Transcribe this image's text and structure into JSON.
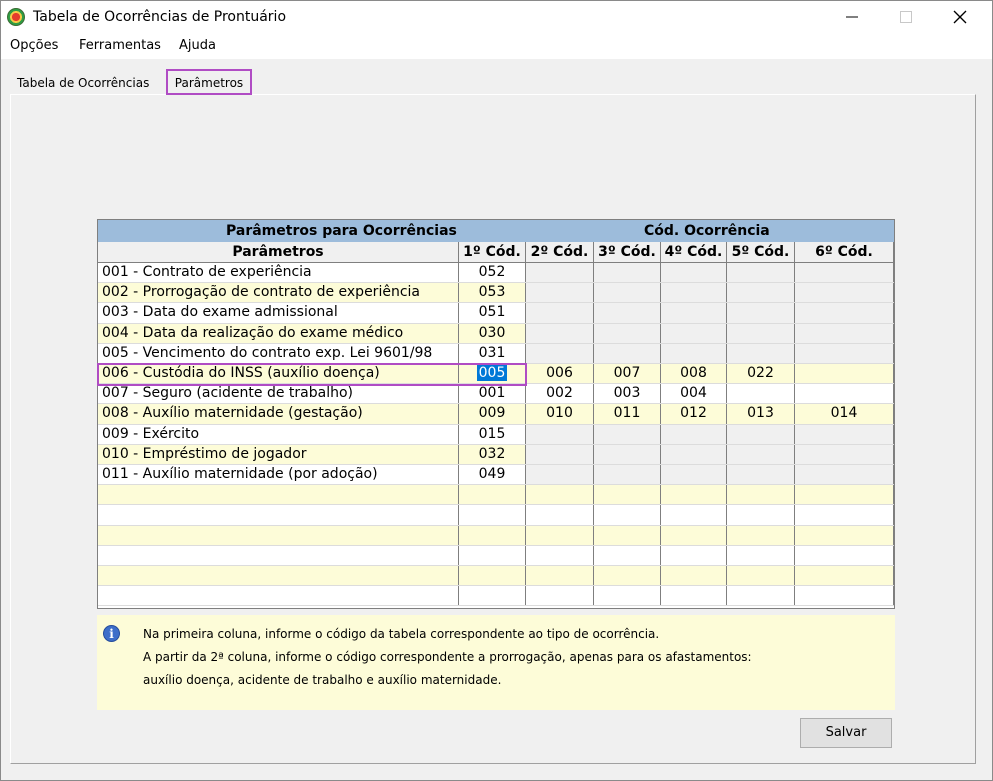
{
  "window": {
    "title": "Tabela de Ocorrências de Prontuário",
    "icon": "app-logo-icon"
  },
  "controls": {
    "minimize": "minimize-icon",
    "maximize": "maximize-icon",
    "close": "close-icon"
  },
  "menu": [
    "Opções",
    "Ferramentas",
    "Ajuda"
  ],
  "tabs": [
    {
      "label": "Tabela de Ocorrências",
      "active": false
    },
    {
      "label": "Parâmetros",
      "active": true
    }
  ],
  "grid": {
    "group_headers": {
      "params": "Parâmetros para Ocorrências",
      "codes": "Cód. Ocorrência"
    },
    "headers": [
      "Parâmetros",
      "1º Cód.",
      "2º Cód.",
      "3º Cód.",
      "4º Cód.",
      "5º Cód.",
      "6º Cód."
    ],
    "rows": [
      [
        "001 - Contrato de experiência",
        "052",
        "",
        "",
        "",
        "",
        ""
      ],
      [
        "002 - Prorrogação de contrato de experiência",
        "053",
        "",
        "",
        "",
        "",
        ""
      ],
      [
        "003 - Data do exame admissional",
        "051",
        "",
        "",
        "",
        "",
        ""
      ],
      [
        "004 - Data da realização do exame médico",
        "030",
        "",
        "",
        "",
        "",
        ""
      ],
      [
        "005 - Vencimento do contrato exp. Lei 9601/98",
        "031",
        "",
        "",
        "",
        "",
        ""
      ],
      [
        "006 - Custódia do INSS (auxílio doença)",
        "005",
        "006",
        "007",
        "008",
        "022",
        ""
      ],
      [
        "007 - Seguro (acidente de trabalho)",
        "001",
        "002",
        "003",
        "004",
        "",
        ""
      ],
      [
        "008 - Auxílio maternidade (gestação)",
        "009",
        "010",
        "011",
        "012",
        "013",
        "014"
      ],
      [
        "009 - Exército",
        "015",
        "",
        "",
        "",
        "",
        ""
      ],
      [
        "010 - Empréstimo de jogador",
        "032",
        "",
        "",
        "",
        "",
        ""
      ],
      [
        "011 - Auxílio maternidade (por adoção)",
        "049",
        "",
        "",
        "",
        "",
        ""
      ],
      [
        "",
        "",
        "",
        "",
        "",
        "",
        ""
      ],
      [
        "",
        "",
        "",
        "",
        "",
        "",
        ""
      ],
      [
        "",
        "",
        "",
        "",
        "",
        "",
        ""
      ],
      [
        "",
        "",
        "",
        "",
        "",
        "",
        ""
      ],
      [
        "",
        "",
        "",
        "",
        "",
        "",
        ""
      ],
      [
        "",
        "",
        "",
        "",
        "",
        "",
        ""
      ]
    ],
    "selected": {
      "row": 5,
      "col": 1
    }
  },
  "info": {
    "icon": "info-icon",
    "lines": [
      "Na primeira coluna, informe o código da tabela correspondente ao tipo de ocorrência.",
      "A partir da 2ª coluna, informe o código correspondente a prorrogação, apenas para os afastamentos:",
      "auxílio doença, acidente de trabalho e auxílio maternidade."
    ]
  },
  "buttons": {
    "save": "Salvar"
  },
  "colors": {
    "grid_header": "#9dbcdb",
    "row_alt": "#fdfcd8",
    "highlight": "#b04cc4",
    "selection": "#0078d7"
  }
}
